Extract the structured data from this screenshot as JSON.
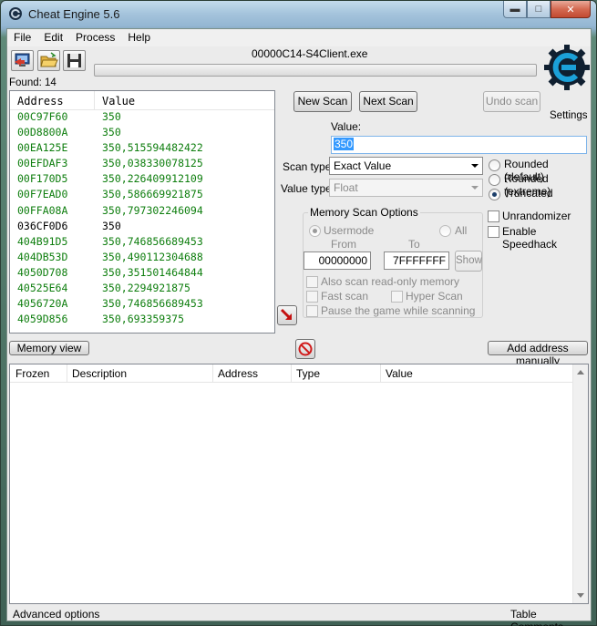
{
  "window": {
    "title": "Cheat Engine 5.6"
  },
  "menu": [
    "File",
    "Edit",
    "Process",
    "Help"
  ],
  "process": {
    "name": "00000C14-S4Client.exe"
  },
  "found_label": "Found: 14",
  "results": {
    "headers": {
      "address": "Address",
      "value": "Value"
    },
    "rows": [
      {
        "address": "00C97F60",
        "value": "350",
        "static": false
      },
      {
        "address": "00D8800A",
        "value": "350",
        "static": false
      },
      {
        "address": "00EA125E",
        "value": "350,515594482422",
        "static": false
      },
      {
        "address": "00EFDAF3",
        "value": "350,038330078125",
        "static": false
      },
      {
        "address": "00F170D5",
        "value": "350,226409912109",
        "static": false
      },
      {
        "address": "00F7EAD0",
        "value": "350,586669921875",
        "static": false
      },
      {
        "address": "00FFA08A",
        "value": "350,797302246094",
        "static": false
      },
      {
        "address": "036CF0D6",
        "value": "350",
        "static": true
      },
      {
        "address": "404B91D5",
        "value": "350,746856689453",
        "static": false
      },
      {
        "address": "404DB53D",
        "value": "350,490112304688",
        "static": false
      },
      {
        "address": "4050D708",
        "value": "350,351501464844",
        "static": false
      },
      {
        "address": "40525E64",
        "value": "350,2294921875",
        "static": false
      },
      {
        "address": "4056720A",
        "value": "350,746856689453",
        "static": false
      },
      {
        "address": "4059D856",
        "value": "350,693359375",
        "static": false
      }
    ]
  },
  "scan": {
    "new_scan": "New Scan",
    "next_scan": "Next Scan",
    "undo_scan": "Undo scan",
    "settings": "Settings",
    "value_label": "Value:",
    "value": "350",
    "scan_type_label": "Scan type",
    "scan_type": "Exact Value",
    "value_type_label": "Value type",
    "value_type": "Float",
    "rounding": {
      "rounded_default": "Rounded (default)",
      "rounded_extreme": "Rounded (extreme)",
      "truncated": "Truncated",
      "selected": "truncated"
    },
    "unrandomizer": "Unrandomizer",
    "enable_speedhack": "Enable Speedhack"
  },
  "memory_scan_options": {
    "title": "Memory Scan Options",
    "usermode": "Usermode",
    "all": "All",
    "from_label": "From",
    "to_label": "To",
    "from_value": "00000000",
    "to_value": "7FFFFFFF",
    "show": "Show",
    "also_scan_readonly": "Also scan read-only memory",
    "fast_scan": "Fast scan",
    "hyper_scan": "Hyper Scan",
    "pause_game": "Pause the game while scanning"
  },
  "bottom_bar": {
    "memory_view": "Memory view",
    "add_address_manually": "Add address manually"
  },
  "address_list": {
    "columns": [
      "Frozen",
      "Description",
      "Address",
      "Type",
      "Value"
    ]
  },
  "status": {
    "advanced_options": "Advanced options",
    "table_comments": "Table Comments"
  },
  "colors": {
    "result_dynamic": "#0e7e0e",
    "result_static": "#000000",
    "selection": "#3399ff"
  }
}
